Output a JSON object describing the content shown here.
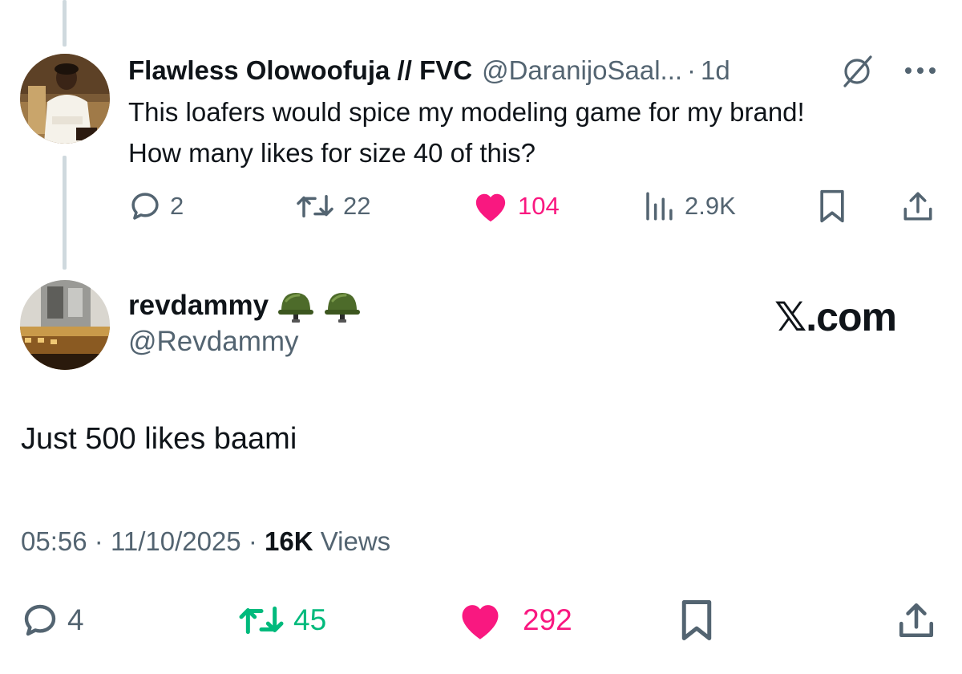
{
  "parent_post": {
    "display_name": "Flawless Olowoofuja // FVC",
    "handle": "@DaranijoSaal...",
    "separator": "·",
    "age": "1d",
    "text_line_1": "This loafers would spice my modeling game for my brand!",
    "text_line_2": "How many likes for size 40 of this?",
    "stats": {
      "replies": "2",
      "reposts": "22",
      "likes": "104",
      "views": "2.9K"
    },
    "icons": [
      "grok-icon",
      "more-icon",
      "reply-icon",
      "repost-icon",
      "like-icon",
      "views-icon",
      "bookmark-icon",
      "share-icon"
    ]
  },
  "reply_post": {
    "display_name": "revdammy",
    "emoji": "🪖🪖",
    "handle": "@Revdammy",
    "text": "Just 500 likes baami",
    "time": "05:56",
    "date": "11/10/2025",
    "meta_separator": "·",
    "views_count": "16K",
    "views_label": "Views",
    "stats": {
      "replies": "4",
      "reposts": "45",
      "likes": "292"
    }
  },
  "watermark": "𝕏.com",
  "colors": {
    "text_primary": "#0f1419",
    "text_secondary": "#536471",
    "like_pink": "#f91880",
    "repost_green": "#00ba7c",
    "thread_line": "#cfd9de"
  }
}
